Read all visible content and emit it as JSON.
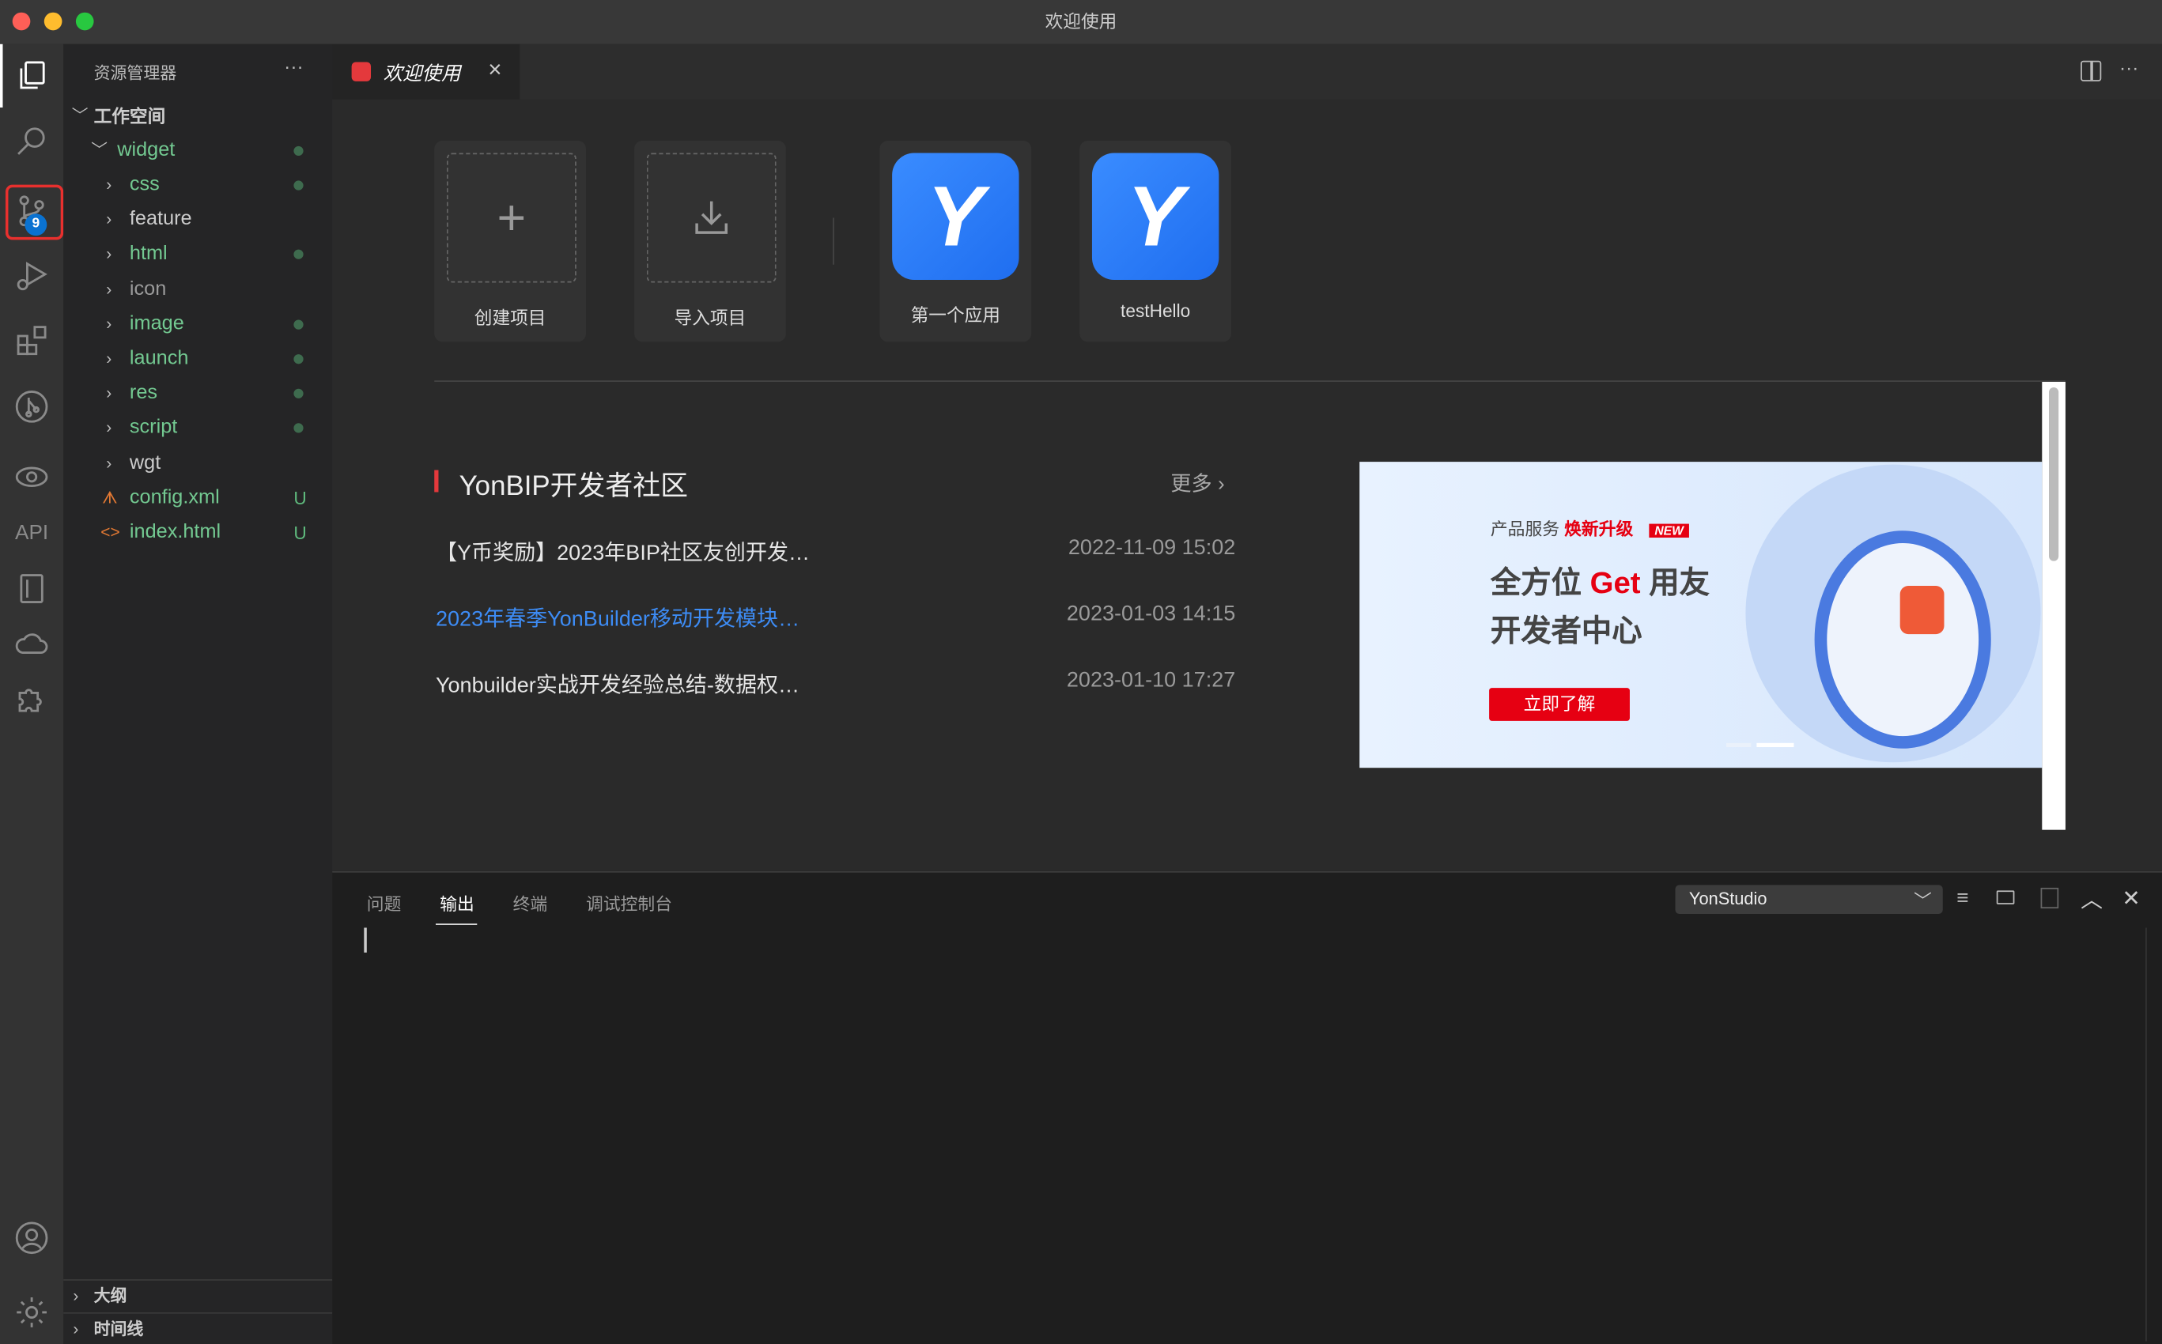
{
  "window": {
    "title": "欢迎使用"
  },
  "activity_bar": {
    "scm_badge": "9",
    "api_label": "API"
  },
  "sidebar": {
    "title": "资源管理器",
    "more": "···",
    "workspace": "工作空间",
    "root": "widget",
    "items": [
      {
        "name": "css",
        "type": "folder",
        "status": "dot",
        "color": "#73c991"
      },
      {
        "name": "feature",
        "type": "folder",
        "status": "",
        "color": "#cccccc"
      },
      {
        "name": "html",
        "type": "folder",
        "status": "dot",
        "color": "#73c991"
      },
      {
        "name": "icon",
        "type": "folder",
        "status": "",
        "color": "#9a9a9a"
      },
      {
        "name": "image",
        "type": "folder",
        "status": "dot",
        "color": "#73c991"
      },
      {
        "name": "launch",
        "type": "folder",
        "status": "dot",
        "color": "#73c991"
      },
      {
        "name": "res",
        "type": "folder",
        "status": "dot",
        "color": "#73c991"
      },
      {
        "name": "script",
        "type": "folder",
        "status": "dot",
        "color": "#73c991"
      },
      {
        "name": "wgt",
        "type": "folder",
        "status": "",
        "color": "#cccccc"
      },
      {
        "name": "config.xml",
        "type": "xml",
        "status": "U",
        "color": "#73c991"
      },
      {
        "name": "index.html",
        "type": "html",
        "status": "U",
        "color": "#73c991"
      }
    ],
    "outline": "大纲",
    "timeline": "时间线"
  },
  "tabs": [
    {
      "label": "欢迎使用",
      "close": "×"
    }
  ],
  "welcome": {
    "actions": [
      {
        "label": "创建项目"
      },
      {
        "label": "导入项目"
      }
    ],
    "recent": [
      {
        "label": "第一个应用"
      },
      {
        "label": "testHello"
      }
    ],
    "community": {
      "title": "YonBIP开发者社区",
      "more": "更多",
      "news": [
        {
          "title": "【Y币奖励】2023年BIP社区友创开发…",
          "date": "2022-11-09 15:02",
          "highlight": false
        },
        {
          "title": "2023年春季YonBuilder移动开发模块…",
          "date": "2023-01-03 14:15",
          "highlight": true
        },
        {
          "title": "Yonbuilder实战开发经验总结-数据权…",
          "date": "2023-01-10 17:27",
          "highlight": false
        }
      ]
    },
    "banner": {
      "tag1": "产品服务",
      "tag2": "焕新升级",
      "new_badge": "NEW",
      "line1a": "全方位",
      "line1b": "Get",
      "line1c": "用友",
      "line2": "开发者中心",
      "button": "立即了解",
      "slide_index": 2,
      "slide_count": 2
    }
  },
  "panel": {
    "tabs": [
      "问题",
      "输出",
      "终端",
      "调试控制台"
    ],
    "active_tab": "输出",
    "channel": "YonStudio"
  }
}
